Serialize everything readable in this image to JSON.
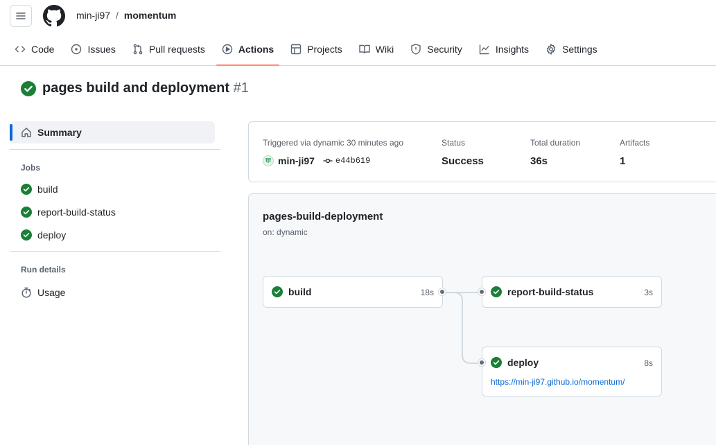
{
  "header": {
    "owner": "min-ji97",
    "separator": "/",
    "repo": "momentum"
  },
  "tabs": [
    {
      "label": "Code",
      "icon": "code-icon"
    },
    {
      "label": "Issues",
      "icon": "issue-icon"
    },
    {
      "label": "Pull requests",
      "icon": "pull-request-icon"
    },
    {
      "label": "Actions",
      "icon": "play-icon",
      "active": true
    },
    {
      "label": "Projects",
      "icon": "table-icon"
    },
    {
      "label": "Wiki",
      "icon": "book-icon"
    },
    {
      "label": "Security",
      "icon": "shield-icon"
    },
    {
      "label": "Insights",
      "icon": "graph-icon"
    },
    {
      "label": "Settings",
      "icon": "gear-icon"
    }
  ],
  "run": {
    "title": "pages build and deployment",
    "number": "#1"
  },
  "sidebar": {
    "summary_label": "Summary",
    "jobs_heading": "Jobs",
    "jobs": [
      "build",
      "report-build-status",
      "deploy"
    ],
    "run_details_heading": "Run details",
    "usage_label": "Usage"
  },
  "summary": {
    "triggered_label": "Triggered via dynamic 30 minutes ago",
    "user": "min-ji97",
    "commit": "e44b619",
    "status_label": "Status",
    "status_value": "Success",
    "duration_label": "Total duration",
    "duration_value": "36s",
    "artifacts_label": "Artifacts",
    "artifacts_value": "1"
  },
  "workflow": {
    "name": "pages-build-deployment",
    "trigger": "on: dynamic",
    "jobs": {
      "build": {
        "name": "build",
        "duration": "18s"
      },
      "report": {
        "name": "report-build-status",
        "duration": "3s"
      },
      "deploy": {
        "name": "deploy",
        "duration": "8s",
        "url": "https://min-ji97.github.io/momentum/"
      }
    }
  },
  "colors": {
    "success": "#1a7f37",
    "accent": "#0969da",
    "tab_underline": "#fd8c73"
  }
}
